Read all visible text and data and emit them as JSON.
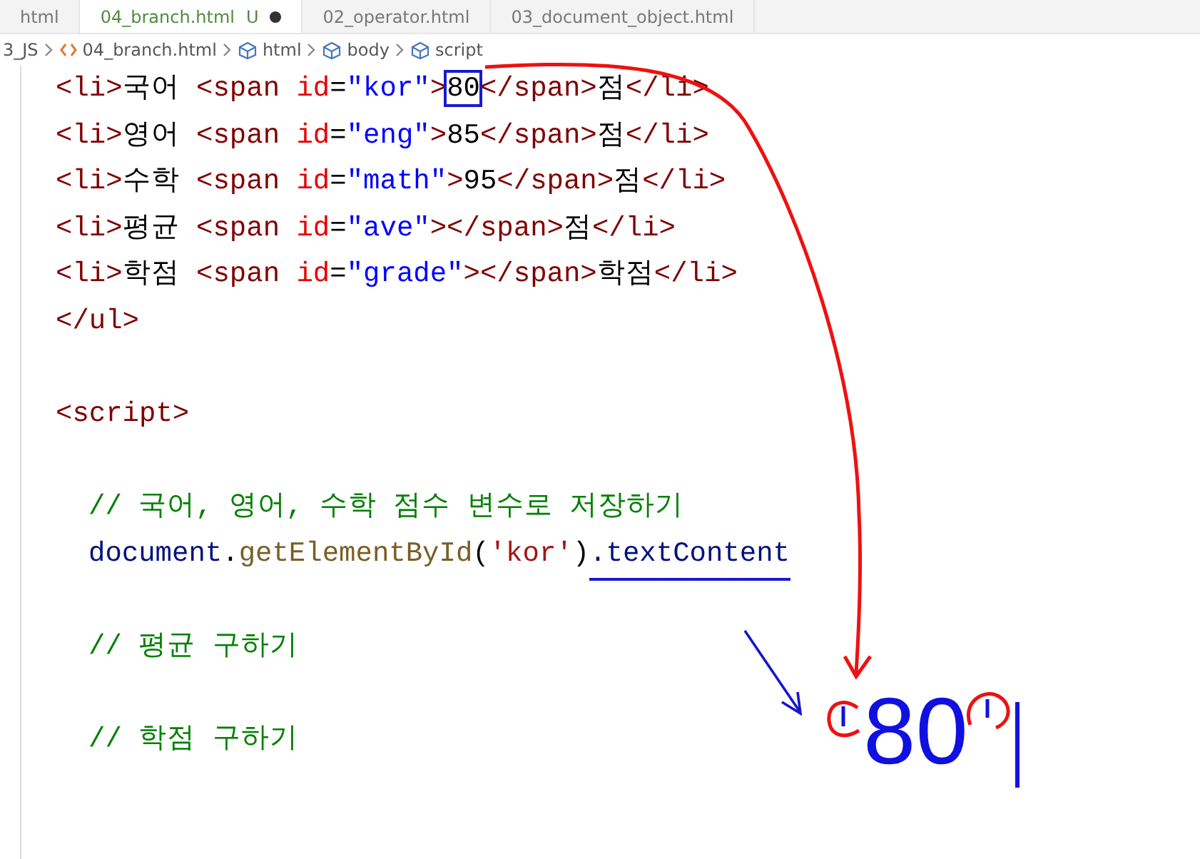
{
  "tabs": [
    {
      "label": "html",
      "selected": false,
      "unsaved": false
    },
    {
      "label": "04_branch.html",
      "selected": true,
      "status": "U",
      "unsaved": true
    },
    {
      "label": "02_operator.html",
      "selected": false,
      "unsaved": false
    },
    {
      "label": "03_document_object.html",
      "selected": false,
      "unsaved": false
    }
  ],
  "breadcrumb": [
    {
      "kind": "folder",
      "label": "3_JS"
    },
    {
      "kind": "file",
      "label": "04_branch.html"
    },
    {
      "kind": "element",
      "label": "html"
    },
    {
      "kind": "element",
      "label": "body"
    },
    {
      "kind": "element",
      "label": "script"
    }
  ],
  "code_lines": [
    {
      "kind": "code",
      "indented": false,
      "tokens": [
        {
          "kind": "tag",
          "text": "<li>"
        },
        {
          "kind": "plain",
          "text": "국어 "
        },
        {
          "kind": "tag",
          "text": "<span "
        },
        {
          "kind": "attr",
          "text": "id"
        },
        {
          "kind": "plain",
          "text": "="
        },
        {
          "kind": "val",
          "text": "\"kor\""
        },
        {
          "kind": "tag",
          "text": ">"
        },
        {
          "kind": "plain",
          "text": "80",
          "boxed": true
        },
        {
          "kind": "tag",
          "text": "</span>"
        },
        {
          "kind": "plain",
          "text": "점"
        },
        {
          "kind": "tag",
          "text": "</li>"
        }
      ]
    },
    {
      "kind": "code",
      "indented": false,
      "tokens": [
        {
          "kind": "tag",
          "text": "<li>"
        },
        {
          "kind": "plain",
          "text": "영어 "
        },
        {
          "kind": "tag",
          "text": "<span "
        },
        {
          "kind": "attr",
          "text": "id"
        },
        {
          "kind": "plain",
          "text": "="
        },
        {
          "kind": "val",
          "text": "\"eng\""
        },
        {
          "kind": "tag",
          "text": ">"
        },
        {
          "kind": "plain",
          "text": "85"
        },
        {
          "kind": "tag",
          "text": "</span>"
        },
        {
          "kind": "plain",
          "text": "점"
        },
        {
          "kind": "tag",
          "text": "</li>"
        }
      ]
    },
    {
      "kind": "code",
      "indented": false,
      "tokens": [
        {
          "kind": "tag",
          "text": "<li>"
        },
        {
          "kind": "plain",
          "text": "수학 "
        },
        {
          "kind": "tag",
          "text": "<span "
        },
        {
          "kind": "attr",
          "text": "id"
        },
        {
          "kind": "plain",
          "text": "="
        },
        {
          "kind": "val",
          "text": "\"math\""
        },
        {
          "kind": "tag",
          "text": ">"
        },
        {
          "kind": "plain",
          "text": "95"
        },
        {
          "kind": "tag",
          "text": "</span>"
        },
        {
          "kind": "plain",
          "text": "점"
        },
        {
          "kind": "tag",
          "text": "</li>"
        }
      ]
    },
    {
      "kind": "code",
      "indented": false,
      "tokens": [
        {
          "kind": "tag",
          "text": "<li>"
        },
        {
          "kind": "plain",
          "text": "평균 "
        },
        {
          "kind": "tag",
          "text": "<span "
        },
        {
          "kind": "attr",
          "text": "id"
        },
        {
          "kind": "plain",
          "text": "="
        },
        {
          "kind": "val",
          "text": "\"ave\""
        },
        {
          "kind": "tag",
          "text": "></span>"
        },
        {
          "kind": "plain",
          "text": "점"
        },
        {
          "kind": "tag",
          "text": "</li>"
        }
      ]
    },
    {
      "kind": "code",
      "indented": false,
      "tokens": [
        {
          "kind": "tag",
          "text": "<li>"
        },
        {
          "kind": "plain",
          "text": "학점 "
        },
        {
          "kind": "tag",
          "text": "<span "
        },
        {
          "kind": "attr",
          "text": "id"
        },
        {
          "kind": "plain",
          "text": "="
        },
        {
          "kind": "val",
          "text": "\"grade\""
        },
        {
          "kind": "tag",
          "text": "></span>"
        },
        {
          "kind": "plain",
          "text": "학점"
        },
        {
          "kind": "tag",
          "text": "</li>"
        }
      ]
    },
    {
      "kind": "code",
      "indented": false,
      "tokens": [
        {
          "kind": "tag",
          "text": "</ul>"
        }
      ]
    },
    {
      "kind": "blank"
    },
    {
      "kind": "code",
      "indented": false,
      "tokens": [
        {
          "kind": "tag",
          "text": "<script>"
        }
      ]
    },
    {
      "kind": "blank"
    },
    {
      "kind": "code",
      "indented": true,
      "tokens": [
        {
          "kind": "comment",
          "text": "// 국어, 영어, 수학 점수 변수로 저장하기"
        }
      ]
    },
    {
      "kind": "code",
      "indented": true,
      "tokens": [
        {
          "kind": "var",
          "text": "document"
        },
        {
          "kind": "plain",
          "text": "."
        },
        {
          "kind": "func",
          "text": "getElementById"
        },
        {
          "kind": "plain",
          "text": "("
        },
        {
          "kind": "str",
          "text": "'kor'"
        },
        {
          "kind": "plain",
          "text": ")"
        },
        {
          "kind": "var",
          "text": ".textContent",
          "underlined": true
        }
      ]
    },
    {
      "kind": "blank"
    },
    {
      "kind": "code",
      "indented": true,
      "tokens": [
        {
          "kind": "comment",
          "text": "// 평균 구하기"
        }
      ]
    },
    {
      "kind": "blank"
    },
    {
      "kind": "code",
      "indented": true,
      "tokens": [
        {
          "kind": "comment",
          "text": "// 학점 구하기"
        }
      ]
    }
  ],
  "handwriting": "80"
}
